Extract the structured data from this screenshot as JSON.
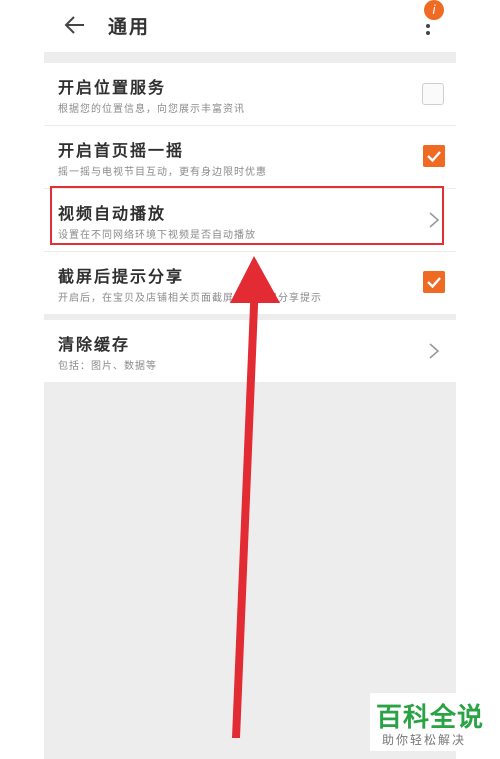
{
  "header": {
    "title": "通用",
    "badge": "i"
  },
  "settings": [
    {
      "title": "开启位置服务",
      "subtitle": "根据您的位置信息，向您展示丰富资讯",
      "control": "checkbox",
      "checked": false
    },
    {
      "title": "开启首页摇一摇",
      "subtitle": "摇一摇与电视节目互动，更有身边限时优惠",
      "control": "checkbox",
      "checked": true
    },
    {
      "title": "视频自动播放",
      "subtitle": "设置在不同网络环境下视频是否自动播放",
      "control": "chevron"
    },
    {
      "title": "截屏后提示分享",
      "subtitle": "开启后，在宝贝及店铺相关页面截屏，会出现分享提示",
      "control": "checkbox",
      "checked": true
    }
  ],
  "cache": {
    "title": "清除缓存",
    "subtitle": "包括：图片、数据等"
  },
  "watermark": {
    "main": "百科全说",
    "sub": "助你轻松解决"
  },
  "colors": {
    "accent": "#ef6a23",
    "highlight": "#e03036",
    "watermark": "#2aa344"
  }
}
